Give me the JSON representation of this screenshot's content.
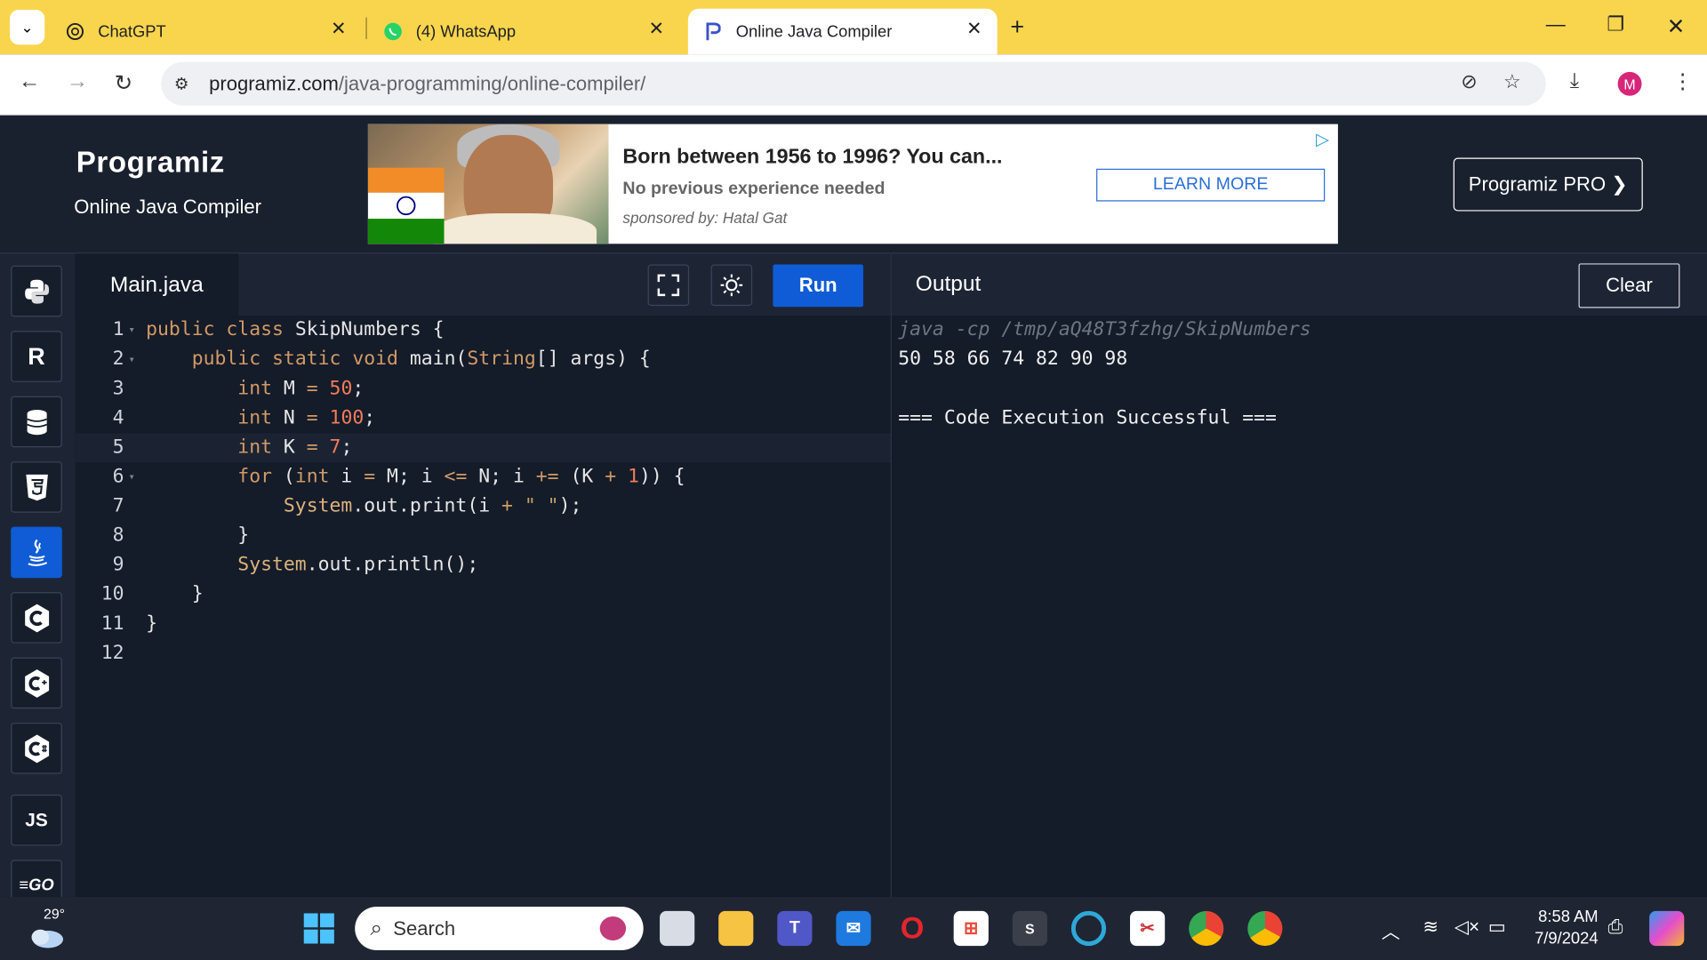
{
  "browser": {
    "tabs": [
      {
        "title": "ChatGPT",
        "icon": "chatgpt-icon"
      },
      {
        "title": "(4) WhatsApp",
        "icon": "whatsapp-icon"
      },
      {
        "title": "Online Java Compiler",
        "icon": "programiz-icon",
        "active": true
      }
    ],
    "url_host": "programiz.com",
    "url_path": "/java-programming/online-compiler/",
    "profile_initial": "M"
  },
  "site": {
    "logo_text": "Programiz",
    "subtitle": "Online Java Compiler",
    "pro_button": "Programiz PRO ❯"
  },
  "ad": {
    "title": "Born between 1956 to 1996? You can...",
    "line": "No previous experience needed",
    "sponsor": "sponsored by: Hatal Gat",
    "cta": "LEARN MORE"
  },
  "languages": [
    {
      "name": "python-icon",
      "glyph": "🐍"
    },
    {
      "name": "r-icon",
      "glyph": "R"
    },
    {
      "name": "sql-icon",
      "glyph": "⛁"
    },
    {
      "name": "html5-icon",
      "glyph": "5"
    },
    {
      "name": "java-icon",
      "glyph": "♨",
      "active": true
    },
    {
      "name": "c-icon",
      "glyph": "C"
    },
    {
      "name": "cpp-icon",
      "glyph": "C"
    },
    {
      "name": "csharp-icon",
      "glyph": "C"
    },
    {
      "name": "javascript-icon",
      "glyph": "JS"
    },
    {
      "name": "go-icon",
      "glyph": "GO"
    }
  ],
  "editor": {
    "filename": "Main.java",
    "run_label": "Run",
    "line_numbers": [
      "1",
      "2",
      "3",
      "4",
      "5",
      "6",
      "7",
      "8",
      "9",
      "10",
      "11",
      "12"
    ]
  },
  "output": {
    "title": "Output",
    "clear_label": "Clear",
    "command": "java -cp /tmp/aQ48T3fzhg/SkipNumbers",
    "result": "50 58 66 74 82 90 98",
    "status": "=== Code Execution Successful ==="
  },
  "taskbar": {
    "temperature": "29°",
    "search_placeholder": "Search",
    "time": "8:58 AM",
    "date": "7/9/2024"
  }
}
